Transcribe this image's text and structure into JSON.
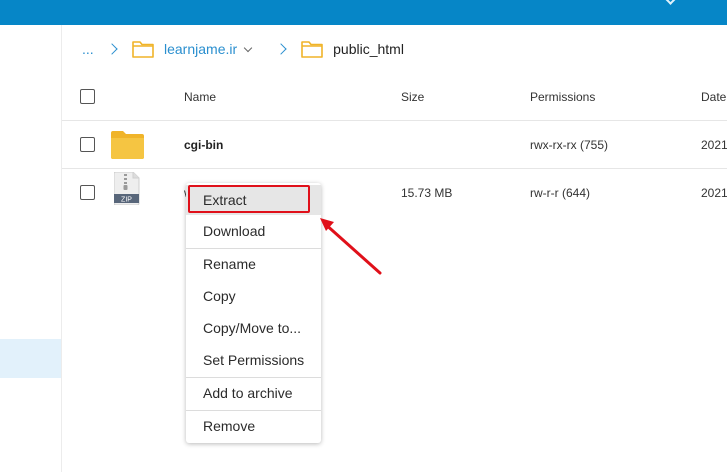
{
  "breadcrumb": {
    "ellipsis": "...",
    "domain": "learnjame.ir",
    "current_folder": "public_html"
  },
  "table": {
    "headers": {
      "name": "Name",
      "size": "Size",
      "permissions": "Permissions",
      "date": "Date"
    },
    "rows": [
      {
        "name": "cgi-bin",
        "size": "",
        "permissions": "rwx-rx-rx (755)",
        "date": "2021",
        "icon": "folder-icon"
      },
      {
        "name": "w",
        "size": "15.73 MB",
        "permissions": "rw-r-r (644)",
        "date": "2021",
        "icon": "zip-file-icon"
      }
    ]
  },
  "zip_icon_label": "ZIP",
  "context_menu": {
    "items": [
      "Extract",
      "Download",
      "Rename",
      "Copy",
      "Copy/Move to...",
      "Set Permissions",
      "Add to archive",
      "Remove"
    ]
  },
  "colors": {
    "topbar": "#0686c7",
    "link": "#2a8fcf",
    "folder": "#f5c542",
    "annotation": "#e0101a",
    "sidebar_active": "#e2f1fb"
  }
}
